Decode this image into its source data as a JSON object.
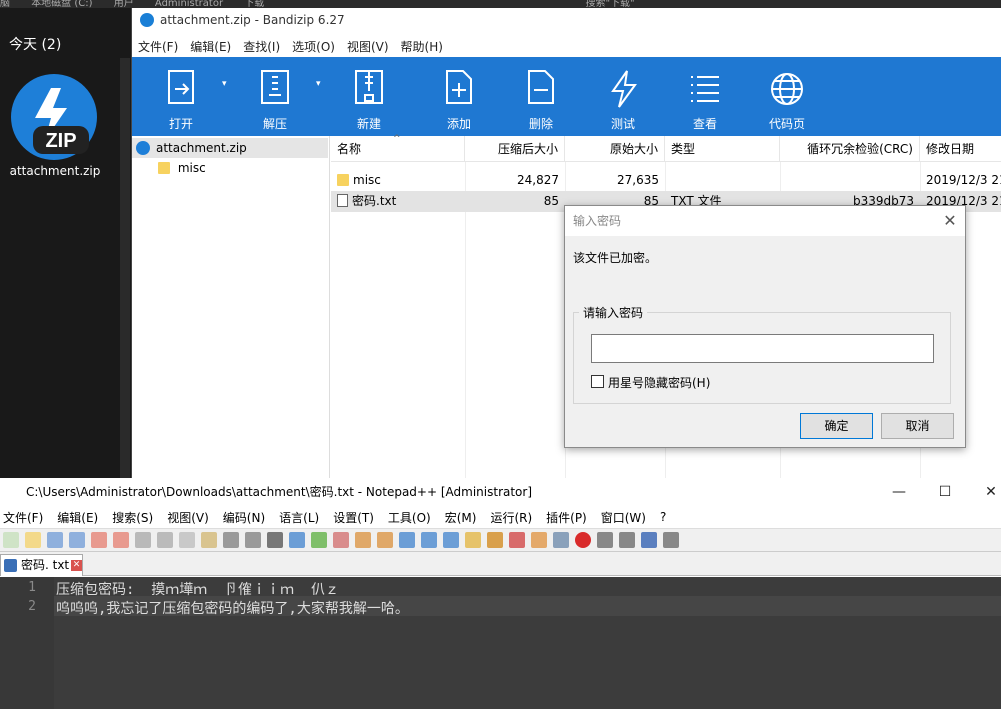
{
  "explorer": {
    "breadcrumb": [
      "脑",
      "本地磁盘 (C:)",
      "用户",
      "Administrator",
      "下载"
    ],
    "search_placeholder": "搜索\"下载\"",
    "group_label": "今天 (2)",
    "file_name": "attachment.zip",
    "zip_badge": "ZIP"
  },
  "bandizip": {
    "title": "attachment.zip - Bandizip 6.27",
    "menu": [
      "文件(F)",
      "编辑(E)",
      "查找(I)",
      "选项(O)",
      "视图(V)",
      "帮助(H)"
    ],
    "toolbar": [
      {
        "label": "打开",
        "icon": "open-icon"
      },
      {
        "label": "解压",
        "icon": "extract-icon"
      },
      {
        "label": "新建",
        "icon": "new-archive-icon"
      },
      {
        "label": "添加",
        "icon": "add-icon"
      },
      {
        "label": "删除",
        "icon": "delete-icon"
      },
      {
        "label": "测试",
        "icon": "test-icon"
      },
      {
        "label": "查看",
        "icon": "view-icon"
      },
      {
        "label": "代码页",
        "icon": "codepage-icon"
      }
    ],
    "tree": [
      {
        "label": "attachment.zip"
      },
      {
        "label": "misc"
      }
    ],
    "columns": [
      "名称",
      "压缩后大小",
      "原始大小",
      "类型",
      "循环冗余检验(CRC)",
      "修改日期"
    ],
    "rows": [
      {
        "name": "misc",
        "packed": "24,827",
        "size": "27,635",
        "type": "",
        "crc": "",
        "date": "2019/12/3 21:"
      },
      {
        "name": "密码.txt",
        "packed": "85",
        "size": "85",
        "type": "TXT 文件",
        "crc": "b339db73",
        "date": "2019/12/3 21:"
      }
    ]
  },
  "dialog": {
    "title": "输入密码",
    "message": "该文件已加密。",
    "group_label": "请输入密码",
    "password_value": "",
    "checkbox_label": "用星号隐藏密码(H)",
    "checkbox_checked": false,
    "ok_label": "确定",
    "cancel_label": "取消"
  },
  "notepad": {
    "title": "C:\\Users\\Administrator\\Downloads\\attachment\\密码.txt - Notepad++ [Administrator]",
    "menu": [
      "文件(F)",
      "编辑(E)",
      "搜索(S)",
      "视图(V)",
      "编码(N)",
      "语言(L)",
      "设置(T)",
      "工具(O)",
      "宏(M)",
      "运行(R)",
      "插件(P)",
      "窗口(W)",
      "?"
    ],
    "tab_label": "密码. txt",
    "lines": [
      {
        "num": "1",
        "text": "压缩包密码:  摸ｍ墷ｍ  卪傕ｉｉｍ  仈ｚ"
      },
      {
        "num": "2",
        "text": "呜呜呜,我忘记了压缩包密码的编码了,大家帮我解一哈。"
      }
    ]
  }
}
